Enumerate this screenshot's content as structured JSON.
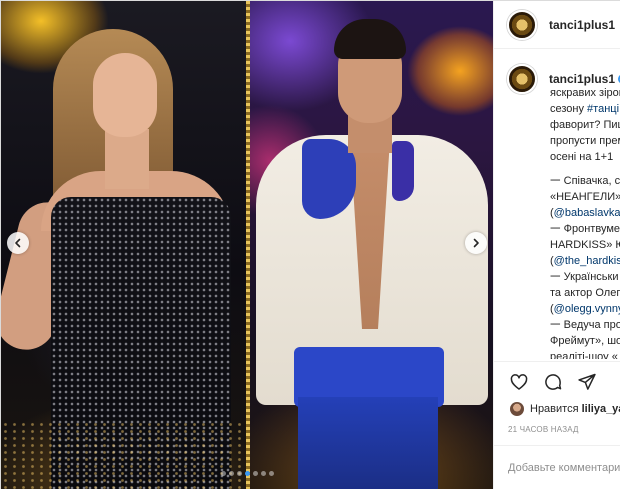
{
  "post": {
    "username": "tanci1plus1",
    "carousel": {
      "slide_count": 7,
      "active_slide": 4
    },
    "caption_lines": [
      "яскравих зірок",
      "сезону #танці",
      "фаворит? Пиш",
      "пропусти прем",
      "осені на 1+1",
      "",
      "𑁋 Співачка, со",
      "«НЕАНГЕЛИ» ",
      "(@babaslavka)",
      "𑁋 Фронтвумен",
      "HARDKISS» Ю",
      "(@the_hardkiss",
      "𑁋 Українськи",
      "та актор Олег",
      "(@olegg.vynny",
      "𑁋 Ведуча про",
      "Фреймут», шо",
      "реаліті-шоу «"
    ],
    "likes": {
      "prefix": "Нравится",
      "user": "liliya_ya"
    },
    "time_ago": "21 ЧАСОВ НАЗАД",
    "comment_placeholder": "Добавьте комментарий"
  },
  "icons": {
    "prev": "chevron-left-icon",
    "next": "chevron-right-icon",
    "like": "heart-icon",
    "comment": "comment-icon",
    "share": "send-icon"
  },
  "colors": {
    "link": "#00376b",
    "verified": "#3897f0",
    "active_dot": "#3897f0",
    "muted": "#8e8e8e"
  }
}
